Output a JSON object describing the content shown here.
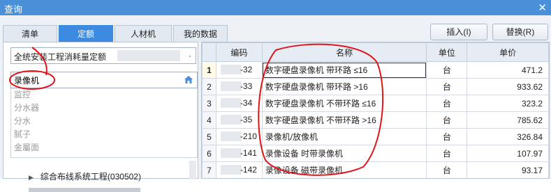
{
  "window": {
    "title": "查询",
    "close_glyph": "✕"
  },
  "tabs": [
    {
      "label": "清单",
      "active": false
    },
    {
      "label": "定额",
      "active": true
    },
    {
      "label": "人材机",
      "active": false
    },
    {
      "label": "我的数据",
      "active": false
    }
  ],
  "toolbar": {
    "insert_label": "插入(I)",
    "replace_label": "替换(R)"
  },
  "quota_select": {
    "value": "全统安装工程消耗量定额",
    "arrow": "·"
  },
  "search": {
    "value": "录像机",
    "placeholder": ""
  },
  "suggestions": [
    "监控",
    "分水器",
    "分水",
    "腻子",
    "金屬面"
  ],
  "tree": {
    "item": "综合布线系统工程(030502)"
  },
  "grid": {
    "headers": {
      "code": "编码",
      "name": "名称",
      "unit": "单位",
      "price": "单价"
    },
    "rows": [
      {
        "no": "1",
        "code": "-32",
        "name": "数字硬盘录像机 带环路 ≤16",
        "unit": "台",
        "price": "471.2"
      },
      {
        "no": "2",
        "code": "-33",
        "name": "数字硬盘录像机 带环路 >16",
        "unit": "台",
        "price": "933.62"
      },
      {
        "no": "3",
        "code": "-34",
        "name": "数字硬盘录像机 不带环路 ≤16",
        "unit": "台",
        "price": "323.2"
      },
      {
        "no": "4",
        "code": "-35",
        "name": "数字硬盘录像机 不带环路 >16",
        "unit": "台",
        "price": "785.62"
      },
      {
        "no": "5",
        "code": "-210",
        "name": "录像机/放像机",
        "unit": "台",
        "price": "326.84"
      },
      {
        "no": "6",
        "code": "-141",
        "name": "录像设备 时带录像机",
        "unit": "台",
        "price": "107.97"
      },
      {
        "no": "7",
        "code": "-142",
        "name": "录像设备 磁带录像机",
        "unit": "台",
        "price": "93.17"
      }
    ]
  },
  "colors": {
    "accent": "#3d8be0",
    "titlebar": "#4a90d9",
    "annotation": "#e0141a"
  }
}
